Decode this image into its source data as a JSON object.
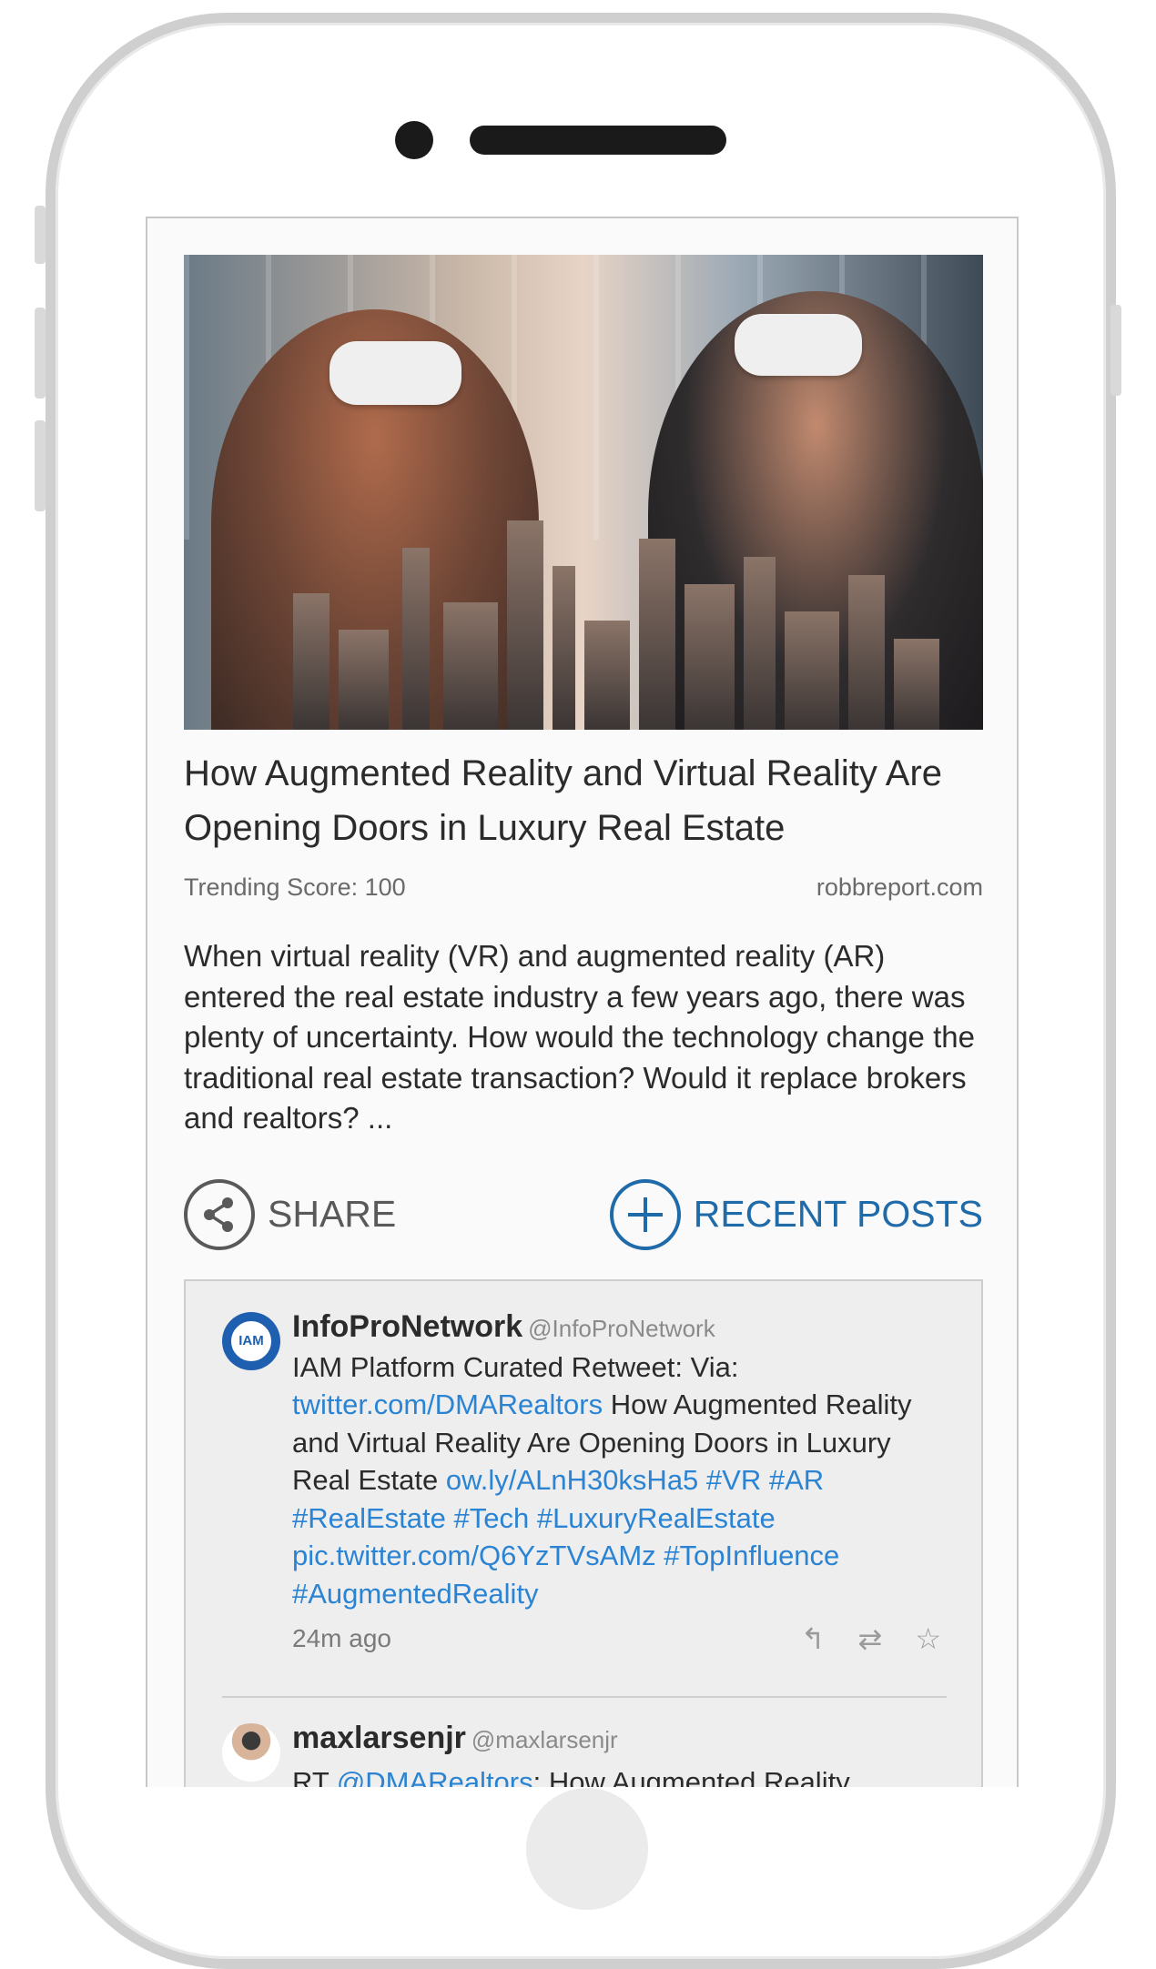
{
  "article": {
    "headline": "How Augmented Reality and Virtual Reality Are Opening Doors in Luxury Real Estate",
    "trending_score": "Trending Score: 100",
    "source": "robbreport.com",
    "excerpt": "When virtual reality (VR) and augmented reality (AR) entered the real estate industry a few years ago, there was plenty of uncertainty. How would the technology change the traditional real estate transaction? Would it replace brokers and realtors? ..."
  },
  "actions": {
    "share_label": "SHARE",
    "recent_posts_label": "RECENT POSTS"
  },
  "tweets": [
    {
      "name": "InfoProNetwork",
      "handle": "@InfoProNetwork",
      "avatar_text": "IAM",
      "text_1": "IAM Platform Curated Retweet: Via: ",
      "link_1": "twitter.com/DMARealtors",
      "text_2": " How Augmented Reality and Virtual Reality Are Opening Doors in Luxury Real Estate ",
      "link_2": "ow.ly/ALnH30ksHa5 #VR #AR #RealEstate #Tech #LuxuryRealEstate pic.twitter.com/Q6YzTVsAMz #TopInfluence #AugmentedReality",
      "time": "24m ago"
    },
    {
      "name": "maxlarsenjr",
      "handle": "@maxlarsenjr",
      "text_1": "RT ",
      "link_1": "@DMARealtors",
      "text_2": ": How Augmented Reality"
    }
  ],
  "icons": {
    "share": "share-icon",
    "recent": "plus-circle-icon",
    "reply": "reply-icon",
    "retweet": "retweet-icon",
    "favorite": "star-icon"
  },
  "colors": {
    "accent": "#1f6aa8",
    "link": "#2b84d3"
  }
}
